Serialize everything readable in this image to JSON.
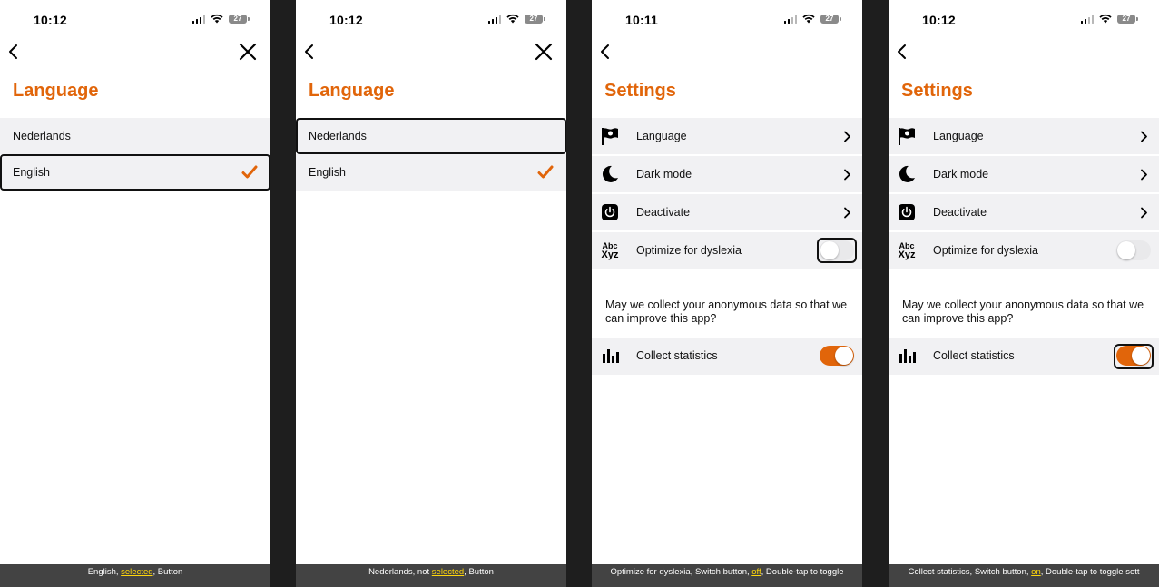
{
  "colors": {
    "accent": "#e1650a",
    "row_bg": "#f1f1f3",
    "caption_bg": "#434343",
    "caption_highlight": "#ffd60a"
  },
  "screens": [
    {
      "time": "10:12",
      "battery": "27",
      "title": "Language",
      "items": [
        {
          "label": "Nederlands"
        },
        {
          "label": "English",
          "checked": true
        }
      ],
      "caption": {
        "pre": "English, ",
        "hl": "selected",
        "post": ", Button"
      }
    },
    {
      "time": "10:12",
      "battery": "27",
      "title": "Language",
      "items": [
        {
          "label": "Nederlands"
        },
        {
          "label": "English",
          "checked": true
        }
      ],
      "caption": {
        "pre": "Nederlands, not ",
        "hl": "selected",
        "post": ", Button"
      }
    },
    {
      "time": "10:11",
      "battery": "27",
      "title": "Settings",
      "items": [
        {
          "label": "Language",
          "icon": "flag-icon"
        },
        {
          "label": "Dark mode",
          "icon": "moon-icon"
        },
        {
          "label": "Deactivate",
          "icon": "power-icon"
        },
        {
          "label": "Optimize for dyslexia",
          "icon": "abc-xyz-icon",
          "icon_text_top": "Abc",
          "icon_text_bottom": "Xyz",
          "toggle": "off"
        }
      ],
      "question": "May we collect your anonymous data so that we can improve this app?",
      "stats": {
        "label": "Collect statistics",
        "icon": "bar-chart-icon",
        "toggle": "on"
      },
      "caption": {
        "pre": "Optimize for dyslexia, Switch button, ",
        "hl": "off",
        "post": ", Double-tap to toggle"
      }
    },
    {
      "time": "10:12",
      "battery": "27",
      "title": "Settings",
      "items": [
        {
          "label": "Language",
          "icon": "flag-icon"
        },
        {
          "label": "Dark mode",
          "icon": "moon-icon"
        },
        {
          "label": "Deactivate",
          "icon": "power-icon"
        },
        {
          "label": "Optimize for dyslexia",
          "icon": "abc-xyz-icon",
          "icon_text_top": "Abc",
          "icon_text_bottom": "Xyz",
          "toggle": "off"
        }
      ],
      "question": "May we collect your anonymous data so that we can improve this app?",
      "stats": {
        "label": "Collect statistics",
        "icon": "bar-chart-icon",
        "toggle": "on"
      },
      "caption": {
        "pre": "Collect statistics, Switch button, ",
        "hl": "on",
        "post": ", Double-tap to toggle sett"
      }
    }
  ]
}
